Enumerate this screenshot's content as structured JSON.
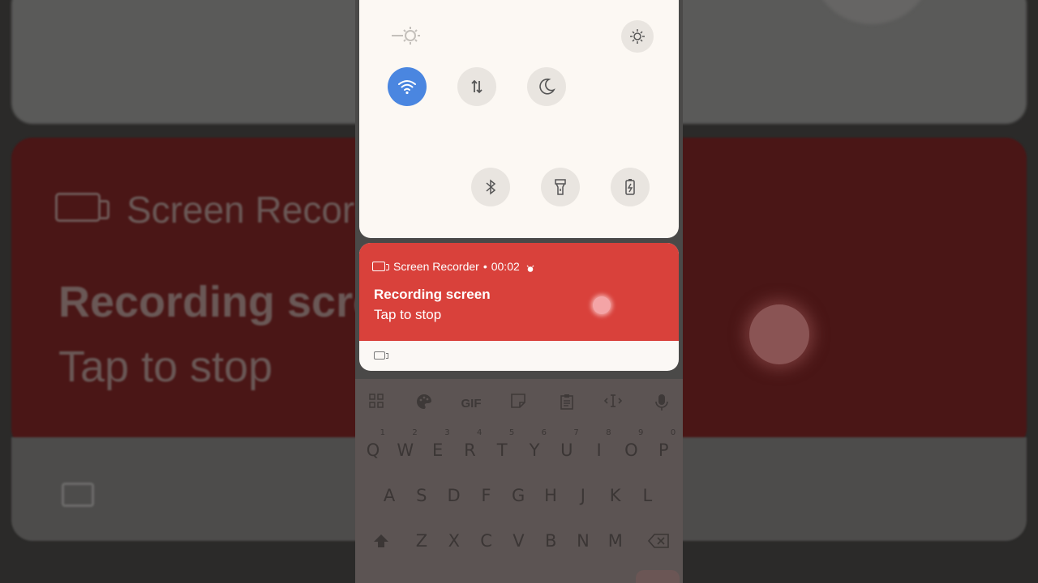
{
  "background": {
    "notification_title": "Screen Recorder",
    "line1": "Recording screen",
    "line2": "Tap to stop"
  },
  "quick_settings": {
    "toggles": [
      "brightness-icon",
      "wifi-icon",
      "data-icon",
      "dnd-icon",
      "bluetooth-icon",
      "flashlight-icon",
      "battery-saver-icon",
      "auto-brightness-icon"
    ],
    "wifi_color": "#4a86e0"
  },
  "notification": {
    "app": "Screen Recorder",
    "separator": "•",
    "elapsed": "00:02",
    "title": "Recording screen",
    "subtitle": "Tap to stop",
    "accent": "#d9413b"
  },
  "keyboard": {
    "toolbar": [
      "grid-icon",
      "palette-icon",
      "GIF",
      "sticker-icon",
      "clipboard-icon",
      "text-cursor-icon",
      "mic-icon"
    ],
    "gif_label": "GIF",
    "row1": [
      "Q",
      "W",
      "E",
      "R",
      "T",
      "Y",
      "U",
      "I",
      "O",
      "P"
    ],
    "row1_hints": [
      "1",
      "2",
      "3",
      "4",
      "5",
      "6",
      "7",
      "8",
      "9",
      "0"
    ],
    "row2": [
      "A",
      "S",
      "D",
      "F",
      "G",
      "H",
      "J",
      "K",
      "L"
    ],
    "row3": [
      "Z",
      "X",
      "C",
      "V",
      "B",
      "N",
      "M"
    ]
  }
}
